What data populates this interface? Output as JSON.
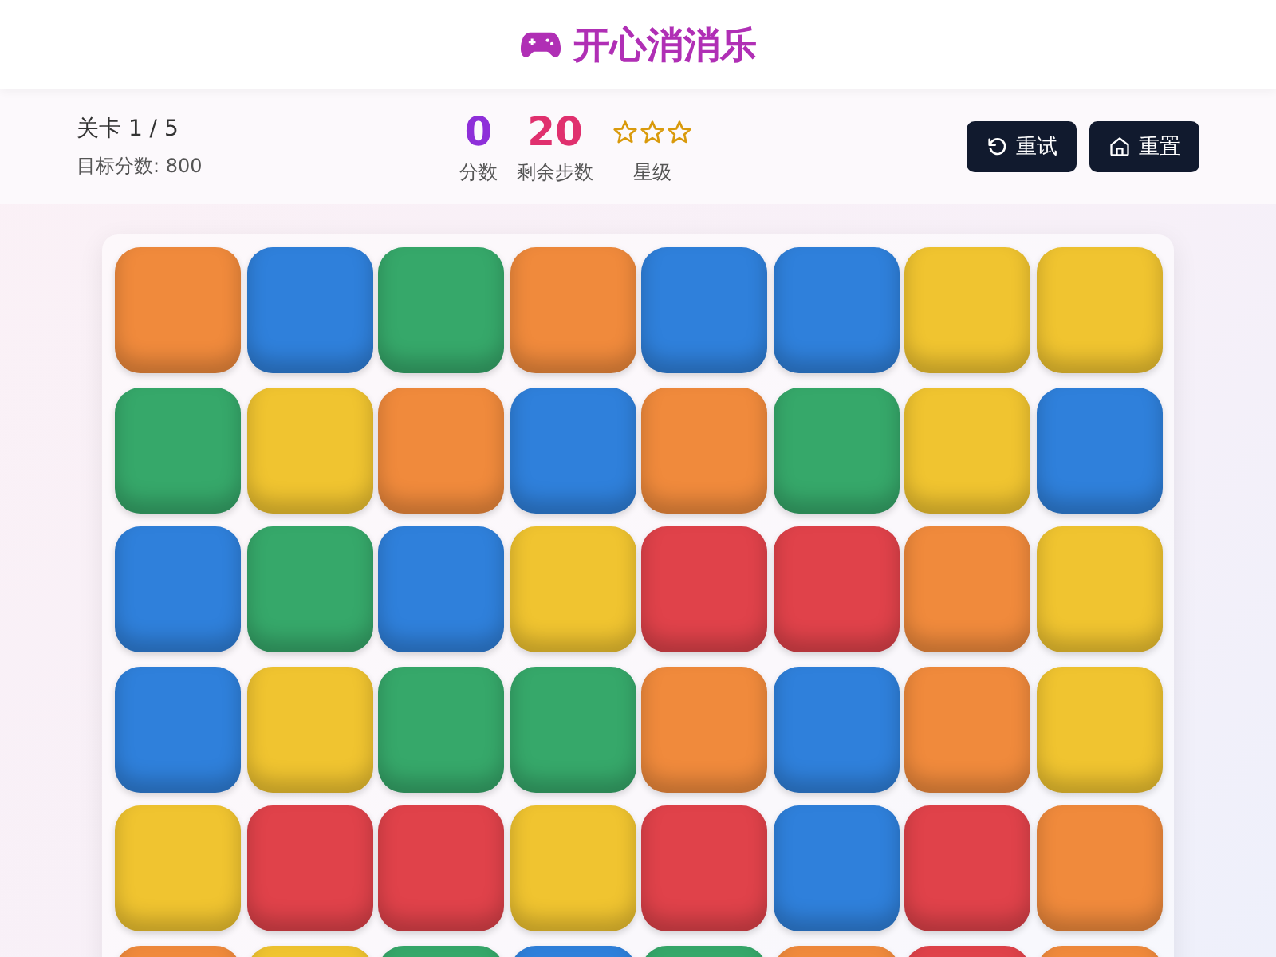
{
  "header": {
    "title": "开心消消乐"
  },
  "level": {
    "label": "关卡 1 / 5",
    "target": "目标分数: 800"
  },
  "stats": {
    "score": {
      "value": "0",
      "label": "分数"
    },
    "moves": {
      "value": "20",
      "label": "剩余步数"
    },
    "rating": {
      "stars": 0,
      "label": "星级"
    }
  },
  "buttons": [
    {
      "kind": "retry",
      "label": "重试"
    },
    {
      "kind": "home",
      "label": "重置"
    }
  ],
  "board": {
    "rows": [
      [
        {
          "color": "#f08a3c"
        },
        {
          "color": "#2f80db"
        },
        {
          "color": "#36a86a"
        },
        {
          "color": "#f08a3c"
        },
        {
          "color": "#2f80db"
        },
        {
          "color": "#2f80db"
        },
        {
          "color": "#f0c430"
        },
        {
          "color": "#f0c430"
        }
      ],
      [
        {
          "color": "#36a86a"
        },
        {
          "color": "#f0c430"
        },
        {
          "color": "#f08a3c"
        },
        {
          "color": "#2f80db"
        },
        {
          "color": "#f08a3c"
        },
        {
          "color": "#36a86a"
        },
        {
          "color": "#f0c430"
        },
        {
          "color": "#2f80db"
        }
      ],
      [
        {
          "color": "#2f80db"
        },
        {
          "color": "#36a86a"
        },
        {
          "color": "#2f80db"
        },
        {
          "color": "#f0c430"
        },
        {
          "color": "#e0424a"
        },
        {
          "color": "#e0424a"
        },
        {
          "color": "#f08a3c"
        },
        {
          "color": "#f0c430"
        }
      ],
      [
        {
          "color": "#2f80db"
        },
        {
          "color": "#f0c430"
        },
        {
          "color": "#36a86a"
        },
        {
          "color": "#36a86a"
        },
        {
          "color": "#f08a3c"
        },
        {
          "color": "#2f80db"
        },
        {
          "color": "#f08a3c"
        },
        {
          "color": "#f0c430"
        }
      ],
      [
        {
          "color": "#f0c430"
        },
        {
          "color": "#e0424a"
        },
        {
          "color": "#e0424a"
        },
        {
          "color": "#f0c430"
        },
        {
          "color": "#e0424a"
        },
        {
          "color": "#2f80db"
        },
        {
          "color": "#e0424a"
        },
        {
          "color": "#f08a3c"
        }
      ],
      [
        {
          "color": "#f08a3c"
        },
        {
          "color": "#f0c430"
        },
        {
          "color": "#36a86a"
        },
        {
          "color": "#2f80db"
        },
        {
          "color": "#36a86a"
        },
        {
          "color": "#f08a3c"
        },
        {
          "color": "#e0424a"
        },
        {
          "color": "#f08a3c"
        }
      ]
    ]
  }
}
